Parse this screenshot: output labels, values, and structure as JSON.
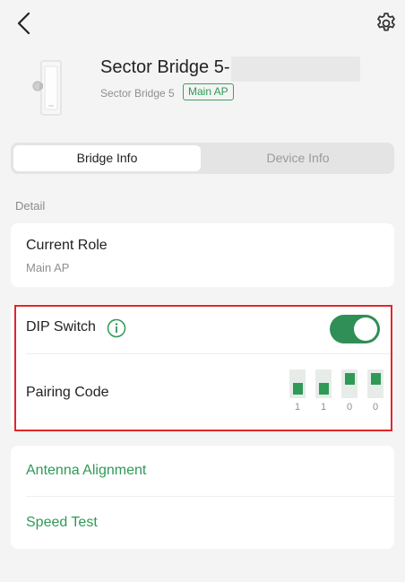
{
  "device": {
    "title": "Sector Bridge 5-",
    "model": "Sector Bridge 5",
    "role_badge": "Main AP"
  },
  "tabs": [
    {
      "label": "Bridge Info",
      "active": true
    },
    {
      "label": "Device Info",
      "active": false
    }
  ],
  "section_label": "Detail",
  "current_role": {
    "label": "Current Role",
    "value": "Main AP"
  },
  "dip_switch": {
    "label": "DIP Switch",
    "enabled": true,
    "toggle_color": "#2f8f57"
  },
  "pairing_code": {
    "label": "Pairing Code",
    "digits": [
      "1",
      "1",
      "0",
      "0"
    ]
  },
  "links": {
    "antenna_alignment": "Antenna Alignment",
    "speed_test": "Speed Test"
  },
  "colors": {
    "accent": "#2e9a56",
    "highlight_border": "#e0262b",
    "background": "#f4f4f4"
  },
  "icons": {
    "back": "chevron-left-icon",
    "settings": "gear-icon",
    "info": "info-circle-icon"
  }
}
